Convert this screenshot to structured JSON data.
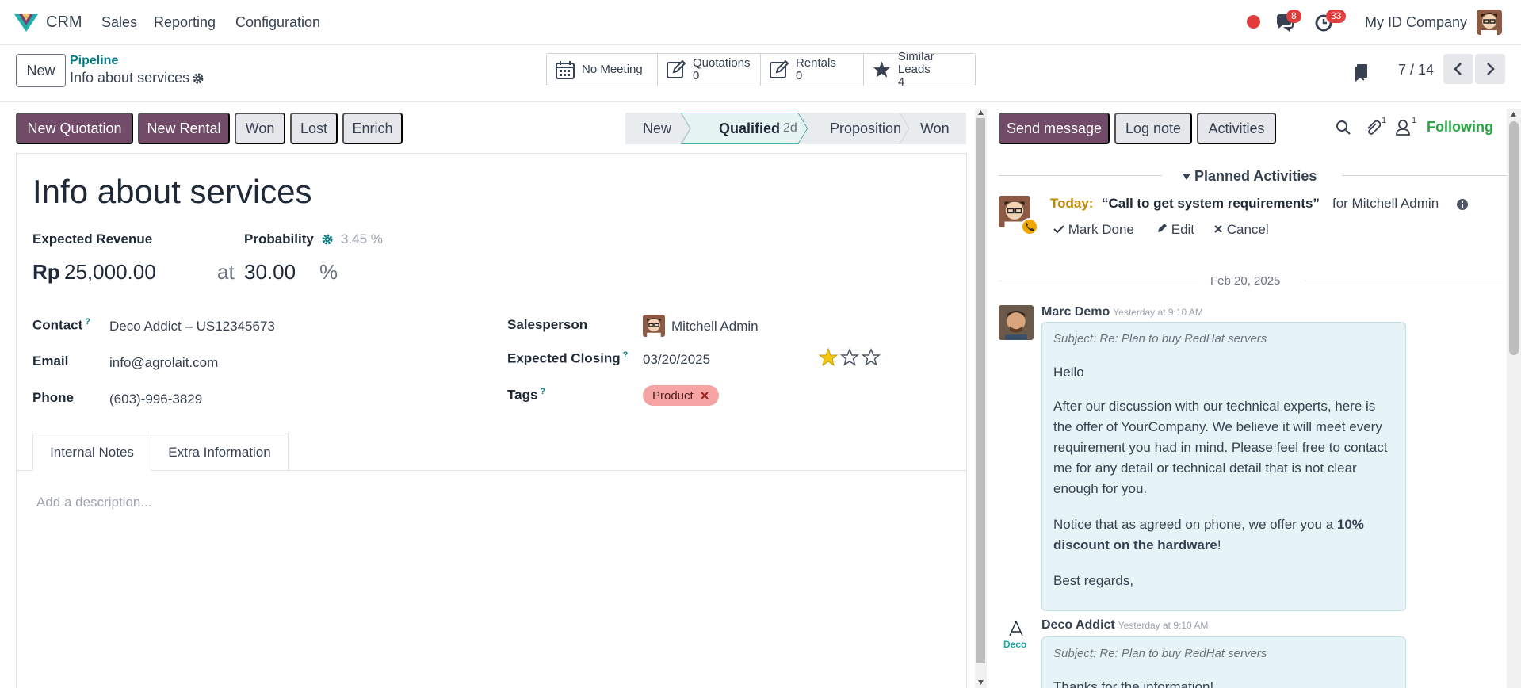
{
  "nav": {
    "app": "CRM",
    "menu": [
      "Sales",
      "Reporting",
      "Configuration"
    ],
    "messages_badge": "8",
    "activities_badge": "33",
    "company": "My ID Company"
  },
  "control": {
    "new_label": "New",
    "breadcrumb": "Pipeline",
    "title": "Info about services",
    "smart_buttons": [
      {
        "label": "No Meeting",
        "count": ""
      },
      {
        "label": "Quotations",
        "count": "0"
      },
      {
        "label": "Rentals",
        "count": "0"
      },
      {
        "label": "Similar Leads",
        "count": "4"
      }
    ],
    "pager": "7 / 14"
  },
  "statusbar": {
    "buttons": [
      "New Quotation",
      "New Rental",
      "Won",
      "Lost",
      "Enrich"
    ],
    "stages": [
      "New",
      "Qualified",
      "Proposition",
      "Won"
    ],
    "active_stage_duration": "2d"
  },
  "form": {
    "name": "Info about services",
    "expected_revenue_label": "Expected Revenue",
    "currency": "Rp",
    "revenue": "25,000.00",
    "at_label": "at",
    "probability_label": "Probability",
    "probability_auto": "3.45 %",
    "probability_value": "30.00",
    "percent": "%",
    "contact_label": "Contact",
    "contact": "Deco Addict – US12345673",
    "email_label": "Email",
    "email": "info@agrolait.com",
    "phone_label": "Phone",
    "phone": "(603)-996-3829",
    "salesperson_label": "Salesperson",
    "salesperson": "Mitchell Admin",
    "closing_label": "Expected Closing",
    "closing": "03/20/2025",
    "priority": 1,
    "tags_label": "Tags",
    "tag": "Product",
    "tabs": [
      "Internal Notes",
      "Extra Information"
    ],
    "description_placeholder": "Add a description..."
  },
  "chatter": {
    "send_message": "Send message",
    "log_note": "Log note",
    "activities": "Activities",
    "attachments_count": "1",
    "followers_count": "1",
    "following": "Following",
    "planned_title": "Planned Activities",
    "activity": {
      "when": "Today:",
      "summary": "“Call to get system requirements”",
      "assignee": "for Mitchell Admin",
      "mark_done": "Mark Done",
      "edit": "Edit",
      "cancel": "Cancel"
    },
    "date_separator": "Feb 20, 2025",
    "messages": [
      {
        "author": "Marc Demo",
        "time": "Yesterday at 9:10 AM",
        "subject": "Subject: Re: Plan to buy RedHat servers",
        "p1": "Hello",
        "p2": "After our discussion with our technical experts, here is the offer of YourCompany. We believe it will meet every requirement you had in mind. Please feel free to contact me for any detail or technical detail that is not clear enough for you.",
        "p3a": "Notice that as agreed on phone, we offer you a ",
        "p3b": "10% discount on the hardware",
        "p3c": "!",
        "p4": "Best regards,"
      },
      {
        "author": "Deco Addict",
        "time": "Yesterday at 9:10 AM",
        "subject": "Subject: Re: Plan to buy RedHat servers",
        "p1": "Thanks for the information!",
        "logo_text": "Deco"
      }
    ]
  },
  "colors": {
    "brand": "#714b67",
    "teal": "#017e84",
    "following": "#28a745",
    "badge": "#e23b3b"
  }
}
